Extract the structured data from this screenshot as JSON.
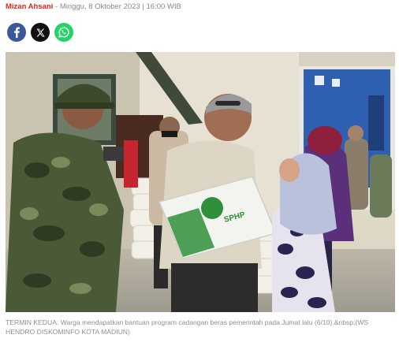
{
  "article": {
    "author": "Mizan Ahsani",
    "date_separator": " - ",
    "date": "Minggu, 8 Oktober 2023 | 16:00 WIB"
  },
  "share": [
    {
      "name": "facebook",
      "icon": "facebook-icon",
      "color": "#3b5998"
    },
    {
      "name": "x",
      "icon": "x-icon",
      "color": "#111111"
    },
    {
      "name": "whatsapp",
      "icon": "whatsapp-icon",
      "color": "#25d366"
    }
  ],
  "photo": {
    "bag_text": "SPHP"
  },
  "caption": "TERMIN KEDUA: Warga mendapatkan bantuan program cadangan beras pemerintah pada Jumat lalu (6/10).&nbsp;(WS HENDRO DISKOMINFO KOTA MADIUN)",
  "colors": {
    "accent": "#e2231a",
    "meta_text": "#8a8a8a",
    "caption_text": "#8f8f8f"
  }
}
